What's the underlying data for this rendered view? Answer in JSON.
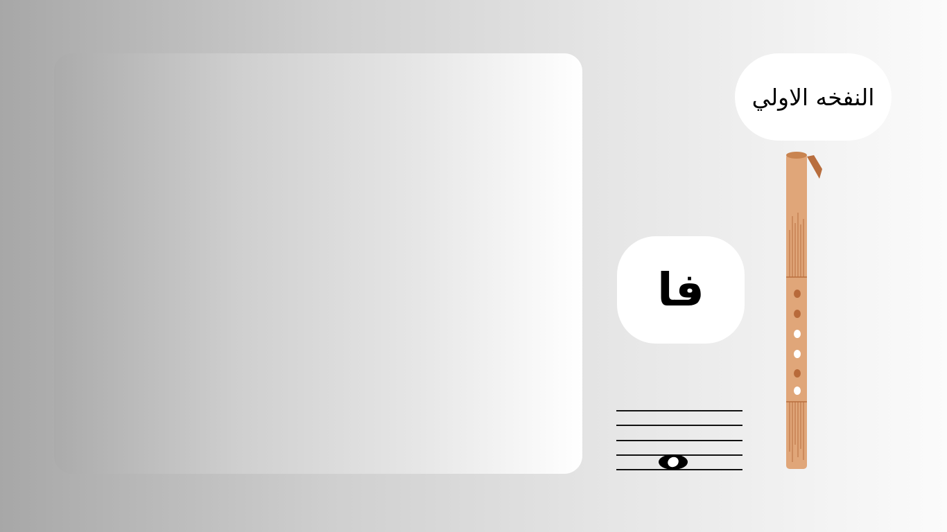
{
  "title_bubble": {
    "text": "النفخه الاولي"
  },
  "note_bubble": {
    "text": "فا"
  },
  "colors": {
    "flute_body": "#e0a679",
    "flute_dark": "#b86e3e",
    "hole_closed": "#b86a3a",
    "hole_open": "#ffffff"
  },
  "flute": {
    "holes": [
      "closed",
      "closed",
      "open",
      "open",
      "closed",
      "open"
    ]
  },
  "staff": {
    "note": "whole-note"
  }
}
